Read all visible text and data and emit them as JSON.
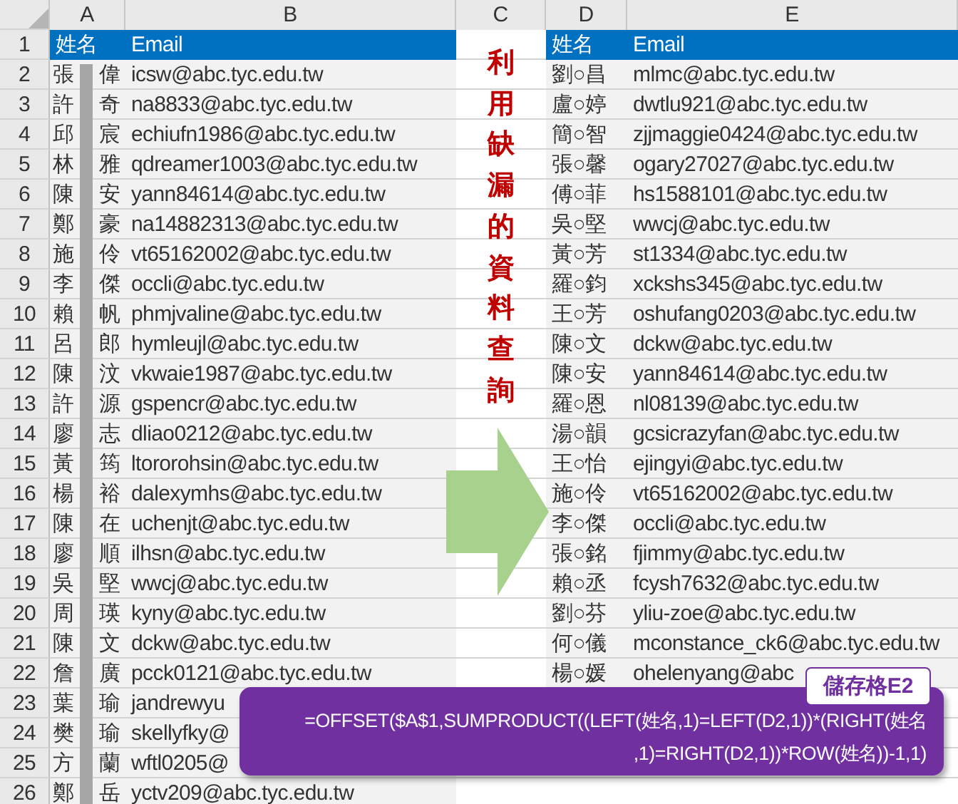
{
  "column_headers": [
    "A",
    "B",
    "C",
    "D",
    "E"
  ],
  "row_numbers": [
    "1",
    "2",
    "3",
    "4",
    "5",
    "6",
    "7",
    "8",
    "9",
    "10",
    "11",
    "12",
    "13",
    "14",
    "15",
    "16",
    "17",
    "18",
    "19",
    "20",
    "21",
    "22",
    "23",
    "24",
    "25",
    "26"
  ],
  "left_table": {
    "headers": [
      "姓名",
      "Email"
    ],
    "rows": [
      {
        "name": "張 偉",
        "email": "icsw@abc.tyc.edu.tw"
      },
      {
        "name": "許 奇",
        "email": "na8833@abc.tyc.edu.tw"
      },
      {
        "name": "邱 宸",
        "email": "echiufn1986@abc.tyc.edu.tw"
      },
      {
        "name": "林 雅",
        "email": "qdreamer1003@abc.tyc.edu.tw"
      },
      {
        "name": "陳 安",
        "email": "yann84614@abc.tyc.edu.tw"
      },
      {
        "name": "鄭 豪",
        "email": "na14882313@abc.tyc.edu.tw"
      },
      {
        "name": "施 伶",
        "email": "vt65162002@abc.tyc.edu.tw"
      },
      {
        "name": "李 傑",
        "email": "occli@abc.tyc.edu.tw"
      },
      {
        "name": "賴 帆",
        "email": "phmjvaline@abc.tyc.edu.tw"
      },
      {
        "name": "呂 郎",
        "email": "hymleujl@abc.tyc.edu.tw"
      },
      {
        "name": "陳 汶",
        "email": "vkwaie1987@abc.tyc.edu.tw"
      },
      {
        "name": "許 源",
        "email": "gspencr@abc.tyc.edu.tw"
      },
      {
        "name": "廖 志",
        "email": "dliao0212@abc.tyc.edu.tw"
      },
      {
        "name": "黃 筠",
        "email": "ltororohsin@abc.tyc.edu.tw"
      },
      {
        "name": "楊 裕",
        "email": "dalexymhs@abc.tyc.edu.tw"
      },
      {
        "name": "陳 在",
        "email": "uchenjt@abc.tyc.edu.tw"
      },
      {
        "name": "廖 順",
        "email": "ilhsn@abc.tyc.edu.tw"
      },
      {
        "name": "吳 堅",
        "email": "wwcj@abc.tyc.edu.tw"
      },
      {
        "name": "周 瑛",
        "email": "kyny@abc.tyc.edu.tw"
      },
      {
        "name": "陳 文",
        "email": "dckw@abc.tyc.edu.tw"
      },
      {
        "name": "詹 廣",
        "email": "pcck0121@abc.tyc.edu.tw"
      },
      {
        "name": "葉 瑜",
        "email": "jandrewyu"
      },
      {
        "name": "樊 瑜",
        "email": "skellyfky@"
      },
      {
        "name": "方 蘭",
        "email": "wftl0205@"
      },
      {
        "name": "鄭 岳",
        "email": "yctv209@abc.tyc.edu.tw"
      }
    ]
  },
  "vertical_title": "利用缺漏的資料查詢",
  "right_table": {
    "headers": [
      "姓名",
      "Email"
    ],
    "rows": [
      {
        "name": "劉○昌",
        "email": "mlmc@abc.tyc.edu.tw"
      },
      {
        "name": "盧○婷",
        "email": "dwtlu921@abc.tyc.edu.tw"
      },
      {
        "name": "簡○智",
        "email": "zjjmaggie0424@abc.tyc.edu.tw"
      },
      {
        "name": "張○馨",
        "email": "ogary27027@abc.tyc.edu.tw"
      },
      {
        "name": "傅○菲",
        "email": "hs1588101@abc.tyc.edu.tw"
      },
      {
        "name": "吳○堅",
        "email": "wwcj@abc.tyc.edu.tw"
      },
      {
        "name": "黃○芳",
        "email": "st1334@abc.tyc.edu.tw"
      },
      {
        "name": "羅○鈞",
        "email": "xckshs345@abc.tyc.edu.tw"
      },
      {
        "name": "王○芳",
        "email": "oshufang0203@abc.tyc.edu.tw"
      },
      {
        "name": "陳○文",
        "email": "dckw@abc.tyc.edu.tw"
      },
      {
        "name": "陳○安",
        "email": "yann84614@abc.tyc.edu.tw"
      },
      {
        "name": "羅○恩",
        "email": "nl08139@abc.tyc.edu.tw"
      },
      {
        "name": "湯○韻",
        "email": "gcsicrazyfan@abc.tyc.edu.tw"
      },
      {
        "name": "王○怡",
        "email": "ejingyi@abc.tyc.edu.tw"
      },
      {
        "name": "施○伶",
        "email": "vt65162002@abc.tyc.edu.tw"
      },
      {
        "name": "李○傑",
        "email": "occli@abc.tyc.edu.tw"
      },
      {
        "name": "張○銘",
        "email": "fjimmy@abc.tyc.edu.tw"
      },
      {
        "name": "賴○丞",
        "email": "fcysh7632@abc.tyc.edu.tw"
      },
      {
        "name": "劉○芬",
        "email": "yliu-zoe@abc.tyc.edu.tw"
      },
      {
        "name": "何○儀",
        "email": "mconstance_ck6@abc.tyc.edu.tw"
      },
      {
        "name": "楊○媛",
        "email": "ohelenyang@abc"
      }
    ]
  },
  "callout": {
    "label": "儲存格E2",
    "formula_lines": [
      "=OFFSET($A$1,SUMPRODUCT((LEFT(姓名,1)=LEFT(D2,1))*(RIGHT(姓名",
      ",1)=RIGHT(D2,1))*ROW(姓名))-1,1)"
    ]
  }
}
